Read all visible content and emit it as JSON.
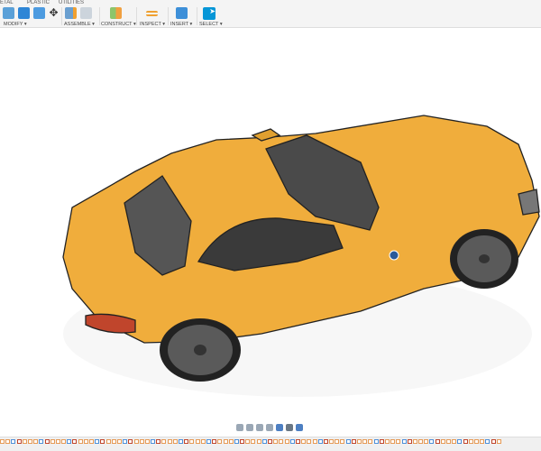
{
  "toolbar": {
    "tabs": [
      "ETAL",
      "PLASTIC",
      "UTILITIES"
    ],
    "groups": [
      {
        "label": "MODIFY ▾",
        "icons": [
          "press-pull-icon",
          "fillet-icon",
          "shell-icon",
          "move-icon"
        ]
      },
      {
        "label": "ASSEMBLE ▾",
        "icons": [
          "new-component-icon",
          "joint-icon"
        ]
      },
      {
        "label": "CONSTRUCT ▾",
        "icons": [
          "offset-plane-icon"
        ]
      },
      {
        "label": "INSPECT ▾",
        "icons": [
          "measure-icon"
        ]
      },
      {
        "label": "INSERT ▾",
        "icons": [
          "insert-image-icon"
        ]
      },
      {
        "label": "SELECT ▾",
        "icons": [
          "select-cursor-icon"
        ]
      }
    ]
  },
  "colors": {
    "body": "#f0ad3c",
    "accent": "#0696d7",
    "timeline_feature": "#e69a55"
  },
  "navbar": {
    "icons": [
      "orbit-icon",
      "pan-icon",
      "zoom-icon",
      "fit-icon",
      "display-settings-icon",
      "grid-icon",
      "viewports-icon"
    ]
  }
}
